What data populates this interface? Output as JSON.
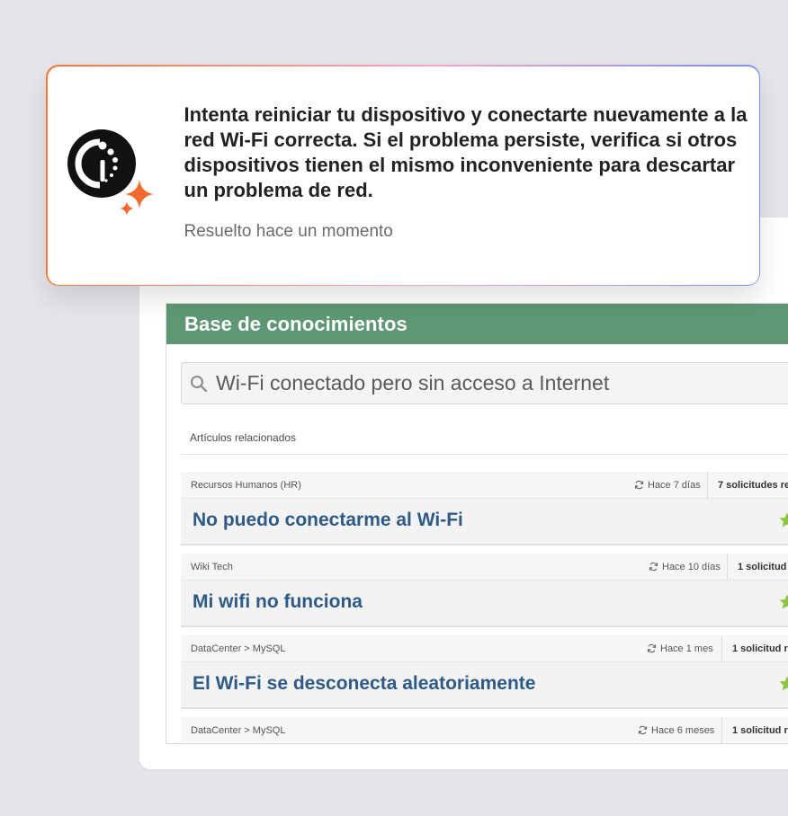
{
  "answer": {
    "text": "Intenta reiniciar tu dispositivo y conectarte nuevamente a la red Wi-Fi correcta. Si el problema persiste, verifica si otros dispositivos tienen el mismo inconveniente para descartar un problema de red.",
    "status": "Resuelto hace un momento",
    "logo_icon": "assistant-logo-icon",
    "sparkle_color": "#f26a2e"
  },
  "kb": {
    "title": "Base de conocimientos",
    "header_color": "#5f9774",
    "search": {
      "value": "Wi-Fi conectado pero sin acceso a Internet",
      "icon": "search-icon"
    },
    "related_label": "Artículos relacionados",
    "articles": [
      {
        "category": "Recursos Humanos (HR)",
        "time": "Hace 7 días",
        "count": "7 solicitudes res",
        "title": "No puedo conectarme al Wi-Fi"
      },
      {
        "category": "Wiki Tech",
        "time": "Hace 10 días",
        "count": "1 solicitud r",
        "title": "Mi wifi no funciona"
      },
      {
        "category": "DataCenter > MySQL",
        "time": "Hace 1 mes",
        "count": "1 solicitud re",
        "title": "El Wi-Fi se desconecta aleatoriamente"
      },
      {
        "category": "DataCenter > MySQL",
        "time": "Hace 6 meses",
        "count": "1 solicitud re",
        "title": ""
      }
    ],
    "title_color": "#2e5a86",
    "star_color": "#8dc63f"
  }
}
